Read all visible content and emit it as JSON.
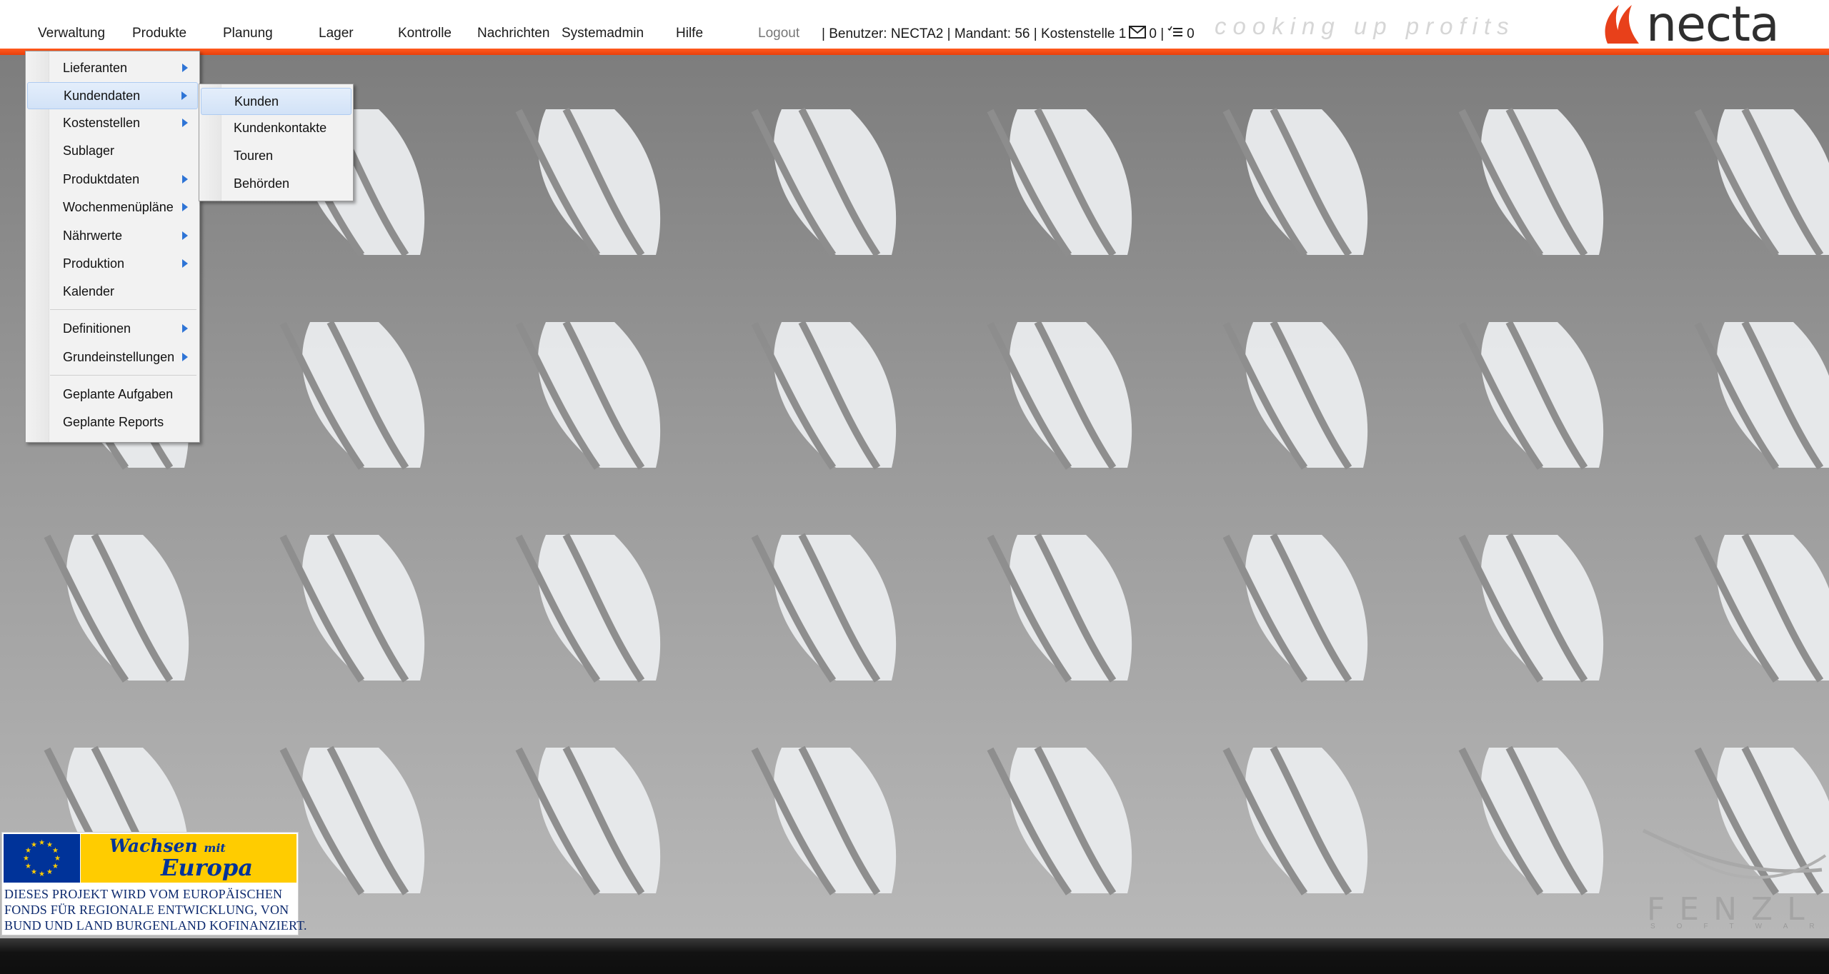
{
  "colors": {
    "accent": "#f05a1e",
    "menu_highlight": "#d2e2f7",
    "arrow": "#2e74d6"
  },
  "nav": {
    "items": [
      {
        "label": "Verwaltung"
      },
      {
        "label": "Produkte"
      },
      {
        "label": "Planung"
      },
      {
        "label": "Lager"
      },
      {
        "label": "Kontrolle"
      },
      {
        "label": "Nachrichten"
      },
      {
        "label": "Systemadmin"
      },
      {
        "label": "Hilfe"
      }
    ],
    "logout": "Logout"
  },
  "status": {
    "user_text": "| Benutzer: NECTA2 | Mandant: 56 | Kostenstelle 1",
    "messages_count": "0 |",
    "tasks_count": "0",
    "mail_icon": "mail-icon",
    "tasks_icon": "task-list-icon"
  },
  "brand": {
    "slogan": "cooking up profits",
    "logo_text": "necta"
  },
  "menu": {
    "items": [
      {
        "label": "Lieferanten"
      },
      {
        "label": "Kundendaten"
      },
      {
        "label": "Kostenstellen"
      },
      {
        "label": "Sublager"
      },
      {
        "label": "Produktdaten"
      },
      {
        "label": "Wochenmenüpläne"
      },
      {
        "label": "Nährwerte"
      },
      {
        "label": "Produktion"
      },
      {
        "label": "Kalender"
      },
      {
        "label": "Definitionen"
      },
      {
        "label": "Grundeinstellungen"
      },
      {
        "label": "Geplante Aufgaben"
      },
      {
        "label": "Geplante Reports"
      }
    ]
  },
  "submenu": {
    "items": [
      {
        "label": "Kunden"
      },
      {
        "label": "Kundenkontakte"
      },
      {
        "label": "Touren"
      },
      {
        "label": "Behörden"
      }
    ]
  },
  "eu_badge": {
    "slogan_part1": "Wachsen",
    "slogan_part2": "mit",
    "slogan_part3": "Europa",
    "line1": "DIESES PROJEKT WIRD VOM EUROPÄISCHEN",
    "line2": "FONDS FÜR REGIONALE ENTWICKLUNG, VON",
    "line3": "BUND UND LAND BURGENLAND KOFINANZIERT."
  },
  "watermark": {
    "name": "FENZL",
    "sub": "SOFTWARE"
  }
}
